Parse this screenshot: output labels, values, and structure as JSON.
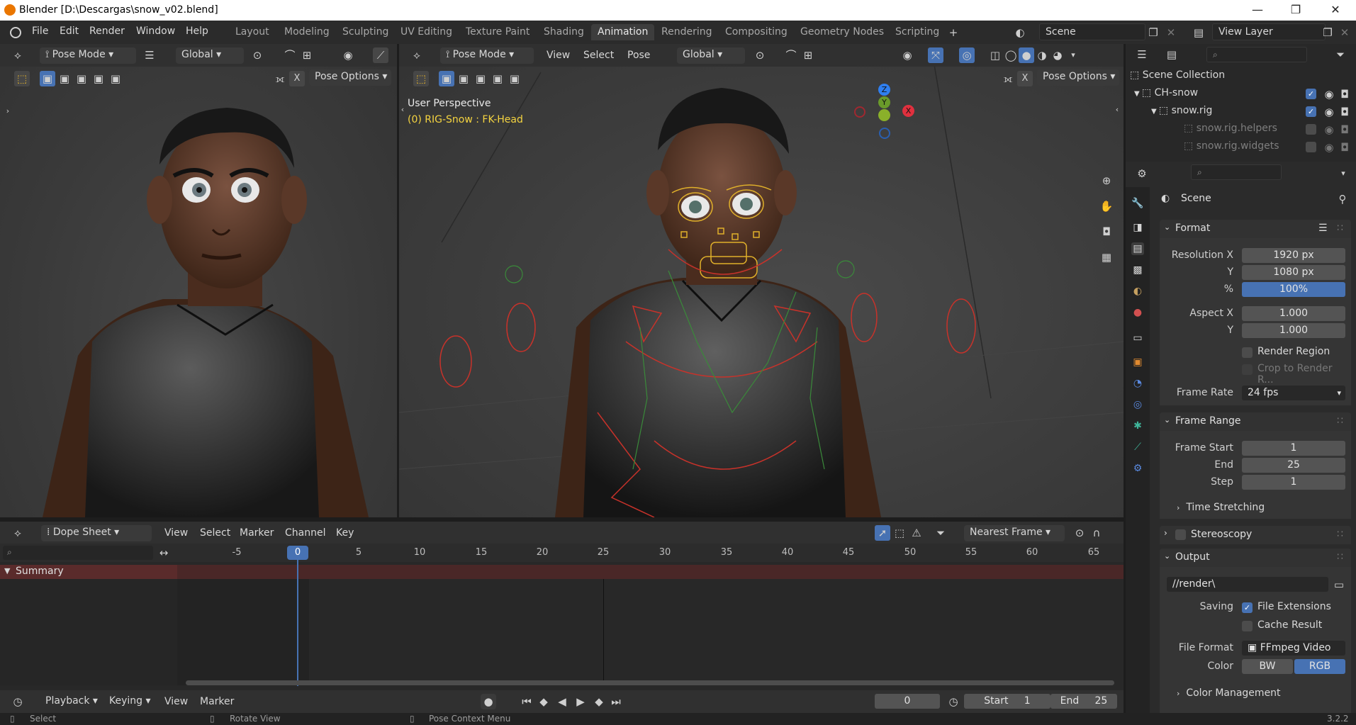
{
  "window": {
    "title": "Blender [D:\\Descargas\\snow_v02.blend]",
    "controls": [
      "—",
      "❐",
      "✕"
    ]
  },
  "menu": [
    "File",
    "Edit",
    "Render",
    "Window",
    "Help"
  ],
  "workspaces": [
    "Layout",
    "Modeling",
    "Sculpting",
    "UV Editing",
    "Texture Paint",
    "Shading",
    "Animation",
    "Rendering",
    "Compositing",
    "Geometry Nodes",
    "Scripting"
  ],
  "active_workspace": "Animation",
  "scene": {
    "name": "Scene",
    "view_layer": "View Layer"
  },
  "left_viewport": {
    "mode": "Pose Mode",
    "orientation": "Global",
    "pose_options": "Pose Options",
    "x_label": "X"
  },
  "right_viewport": {
    "mode": "Pose Mode",
    "menus": [
      "View",
      "Select",
      "Pose"
    ],
    "orientation": "Global",
    "pose_options": "Pose Options",
    "x_label": "X",
    "overlay_title": "User Perspective",
    "overlay_sub": "(0) RIG-Snow : FK-Head",
    "gizmo": {
      "z": "Z",
      "x": "X",
      "y": "Y"
    }
  },
  "dopesheet": {
    "mode": "Dope Sheet",
    "menus": [
      "View",
      "Select",
      "Marker",
      "Channel",
      "Key"
    ],
    "snap": "Nearest Frame",
    "ticks": [
      "-5",
      "0",
      "5",
      "10",
      "15",
      "20",
      "25",
      "30",
      "35",
      "40",
      "45",
      "50",
      "55",
      "60",
      "65"
    ],
    "current_frame": "0",
    "summary_label": "Summary"
  },
  "timeline": {
    "menus": [
      "Playback",
      "Keying",
      "View",
      "Marker"
    ],
    "frame": "0",
    "start_label": "Start",
    "start": "1",
    "end_label": "End",
    "end": "25"
  },
  "status": {
    "select": "Select",
    "rotate": "Rotate View",
    "context": "Pose Context Menu",
    "version": "3.2.2"
  },
  "outliner": {
    "rows": [
      {
        "label": "Scene Collection"
      },
      {
        "label": "CH-snow"
      },
      {
        "label": "snow.rig"
      },
      {
        "label": "snow.rig.helpers"
      },
      {
        "label": "snow.rig.widgets"
      }
    ]
  },
  "properties": {
    "context": "Scene",
    "format": {
      "title": "Format",
      "res_x_label": "Resolution X",
      "res_x": "1920 px",
      "res_y_label": "Y",
      "res_y": "1080 px",
      "pct_label": "%",
      "pct": "100%",
      "aspect_x_label": "Aspect X",
      "aspect_x": "1.000",
      "aspect_y_label": "Y",
      "aspect_y": "1.000",
      "render_region": "Render Region",
      "crop": "Crop to Render R...",
      "frame_rate_label": "Frame Rate",
      "frame_rate": "24 fps"
    },
    "frame_range": {
      "title": "Frame Range",
      "start_label": "Frame Start",
      "start": "1",
      "end_label": "End",
      "end": "25",
      "step_label": "Step",
      "step": "1",
      "time_stretching": "Time Stretching"
    },
    "stereoscopy": "Stereoscopy",
    "output": {
      "title": "Output",
      "path": "//render\\",
      "saving_label": "Saving",
      "file_extensions": "File Extensions",
      "cache_result": "Cache Result",
      "file_format_label": "File Format",
      "file_format": "FFmpeg Video",
      "color_label": "Color",
      "bw": "BW",
      "rgb": "RGB",
      "color_management": "Color Management"
    }
  }
}
